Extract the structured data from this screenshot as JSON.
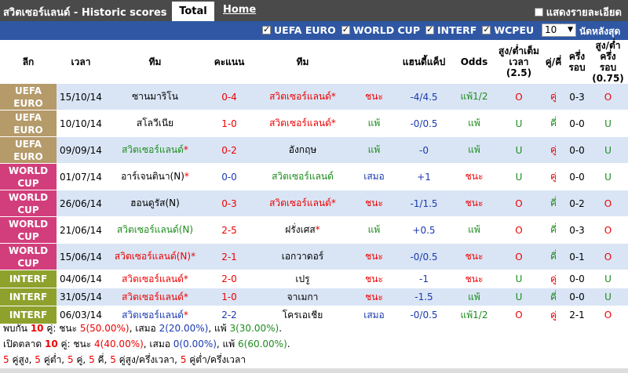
{
  "header": {
    "title": "สวิตเซอร์แลนด์ - Historic scores",
    "tab_total": "Total",
    "tab_home": "Home",
    "show_detail": "แสดงรายละเอียด"
  },
  "filters": [
    {
      "label": "UEFA EURO",
      "checked": true
    },
    {
      "label": "WORLD CUP",
      "checked": true
    },
    {
      "label": "INTERF",
      "checked": true
    },
    {
      "label": "WCPEU",
      "checked": true
    }
  ],
  "count_select": {
    "value": "10",
    "suffix": "นัดหลังสุด"
  },
  "columns": {
    "league": "ลีก",
    "time": "เวลา",
    "home": "ทีม",
    "score": "คะแนน",
    "away": "ทีม",
    "result": "",
    "handicap": "แฮนดี้แค็ป",
    "odds": "Odds",
    "ou_full_1": "สูง/ต่ำเต็ม",
    "ou_full_2": "เวลา",
    "ou_full_3": "(2.5)",
    "oe": "คู่/คี่",
    "half": "ครึ่ง",
    "half2": "รอบ",
    "ou_half_1": "สูง/ต่ำครึ่ง",
    "ou_half_2": "รอบ",
    "ou_half_3": "(0.75)"
  },
  "colors": {
    "uefa": "#b59a6a",
    "worldcup": "#d23e7b",
    "interf": "#8fa12d",
    "row_light": "#d9e5f5",
    "row_white": "#ffffff",
    "red": "#ee0000",
    "green": "#1c8c1c",
    "blue": "#1a3ab0"
  },
  "matches": [
    {
      "league1": "UEFA",
      "league2": "EURO",
      "ltype": "uefa",
      "date": "15/10/14",
      "home": "ซานมาริโน",
      "home_mark": "",
      "home_color": "black",
      "score_h": "0",
      "score_a": "4",
      "score_color": "red",
      "away": "สวิตเซอร์แลนด์",
      "away_mark": "*",
      "away_color": "red",
      "result": "ชนะ",
      "result_color": "red",
      "hcp": "-4/4.5",
      "hcp_color": "blue",
      "odds": "แพ้1/2",
      "odds_color": "green",
      "ou": "O",
      "ou_color": "red",
      "oe": "คู่",
      "oe_color": "red",
      "half": "0-3",
      "hou": "O",
      "hou_color": "red",
      "bg": "light"
    },
    {
      "league1": "UEFA",
      "league2": "EURO",
      "ltype": "uefa",
      "date": "10/10/14",
      "home": "สโลวีเนีย",
      "home_mark": "",
      "home_color": "black",
      "score_h": "1",
      "score_a": "0",
      "score_color": "red",
      "away": "สวิตเซอร์แลนด์",
      "away_mark": "*",
      "away_color": "red",
      "result": "แพ้",
      "result_color": "green",
      "hcp": "-0/0.5",
      "hcp_color": "blue",
      "odds": "แพ้",
      "odds_color": "green",
      "ou": "U",
      "ou_color": "green",
      "oe": "คี่",
      "oe_color": "green",
      "half": "0-0",
      "hou": "U",
      "hou_color": "green",
      "bg": "white"
    },
    {
      "league1": "UEFA",
      "league2": "EURO",
      "ltype": "uefa",
      "date": "09/09/14",
      "home": "สวิตเซอร์แลนด์",
      "home_mark": "*",
      "home_color": "green",
      "score_h": "0",
      "score_a": "2",
      "score_color": "red",
      "away": "อังกฤษ",
      "away_mark": "",
      "away_color": "black",
      "result": "แพ้",
      "result_color": "green",
      "hcp": "-0",
      "hcp_color": "blue",
      "odds": "แพ้",
      "odds_color": "green",
      "ou": "U",
      "ou_color": "green",
      "oe": "คู่",
      "oe_color": "red",
      "half": "0-0",
      "hou": "U",
      "hou_color": "green",
      "bg": "light"
    },
    {
      "league1": "WORLD",
      "league2": "CUP",
      "ltype": "worldcup",
      "date": "01/07/14",
      "home": "อาร์เจนตินา(N)",
      "home_mark": "*",
      "home_color": "black",
      "score_h": "0",
      "score_a": "0",
      "score_color": "blue",
      "away": "สวิตเซอร์แลนด์",
      "away_mark": "",
      "away_color": "green",
      "result": "เสมอ",
      "result_color": "blue",
      "hcp": "+1",
      "hcp_color": "blue",
      "odds": "ชนะ",
      "odds_color": "red",
      "ou": "U",
      "ou_color": "green",
      "oe": "คู่",
      "oe_color": "red",
      "half": "0-0",
      "hou": "U",
      "hou_color": "green",
      "bg": "white"
    },
    {
      "league1": "WORLD",
      "league2": "CUP",
      "ltype": "worldcup",
      "date": "26/06/14",
      "home": "ฮอนดูรัส(N)",
      "home_mark": "",
      "home_color": "black",
      "score_h": "0",
      "score_a": "3",
      "score_color": "red",
      "away": "สวิตเซอร์แลนด์",
      "away_mark": "*",
      "away_color": "red",
      "result": "ชนะ",
      "result_color": "red",
      "hcp": "-1/1.5",
      "hcp_color": "blue",
      "odds": "ชนะ",
      "odds_color": "red",
      "ou": "O",
      "ou_color": "red",
      "oe": "คี่",
      "oe_color": "green",
      "half": "0-2",
      "hou": "O",
      "hou_color": "red",
      "bg": "light"
    },
    {
      "league1": "WORLD",
      "league2": "CUP",
      "ltype": "worldcup",
      "date": "21/06/14",
      "home": "สวิตเซอร์แลนด์(N)",
      "home_mark": "",
      "home_color": "green",
      "score_h": "2",
      "score_a": "5",
      "score_color": "red",
      "away": "ฝรั่งเศส",
      "away_mark": "*",
      "away_color": "black",
      "result": "แพ้",
      "result_color": "green",
      "hcp": "+0.5",
      "hcp_color": "blue",
      "odds": "แพ้",
      "odds_color": "green",
      "ou": "O",
      "ou_color": "red",
      "oe": "คี่",
      "oe_color": "green",
      "half": "0-3",
      "hou": "O",
      "hou_color": "red",
      "bg": "white"
    },
    {
      "league1": "WORLD",
      "league2": "CUP",
      "ltype": "worldcup",
      "date": "15/06/14",
      "home": "สวิตเซอร์แลนด์(N)",
      "home_mark": "*",
      "home_color": "red",
      "score_h": "2",
      "score_a": "1",
      "score_color": "red",
      "away": "เอกวาดอร์",
      "away_mark": "",
      "away_color": "black",
      "result": "ชนะ",
      "result_color": "red",
      "hcp": "-0/0.5",
      "hcp_color": "blue",
      "odds": "ชนะ",
      "odds_color": "red",
      "ou": "O",
      "ou_color": "red",
      "oe": "คี่",
      "oe_color": "green",
      "half": "0-1",
      "hou": "O",
      "hou_color": "red",
      "bg": "light"
    },
    {
      "league1": "INTERF",
      "league2": "",
      "ltype": "interf",
      "date": "04/06/14",
      "home": "สวิตเซอร์แลนด์",
      "home_mark": "*",
      "home_color": "red",
      "score_h": "2",
      "score_a": "0",
      "score_color": "red",
      "away": "เปรู",
      "away_mark": "",
      "away_color": "black",
      "result": "ชนะ",
      "result_color": "red",
      "hcp": "-1",
      "hcp_color": "blue",
      "odds": "ชนะ",
      "odds_color": "red",
      "ou": "U",
      "ou_color": "green",
      "oe": "คู่",
      "oe_color": "red",
      "half": "0-0",
      "hou": "U",
      "hou_color": "green",
      "bg": "white",
      "short": true
    },
    {
      "league1": "INTERF",
      "league2": "",
      "ltype": "interf",
      "date": "31/05/14",
      "home": "สวิตเซอร์แลนด์",
      "home_mark": "*",
      "home_color": "red",
      "score_h": "1",
      "score_a": "0",
      "score_color": "red",
      "away": "จาเมกา",
      "away_mark": "",
      "away_color": "black",
      "result": "ชนะ",
      "result_color": "red",
      "hcp": "-1.5",
      "hcp_color": "blue",
      "odds": "แพ้",
      "odds_color": "green",
      "ou": "U",
      "ou_color": "green",
      "oe": "คี่",
      "oe_color": "green",
      "half": "0-0",
      "hou": "U",
      "hou_color": "green",
      "bg": "light",
      "short": true
    },
    {
      "league1": "INTERF",
      "league2": "",
      "ltype": "interf",
      "date": "06/03/14",
      "home": "สวิตเซอร์แลนด์",
      "home_mark": "*",
      "home_color": "blue",
      "score_h": "2",
      "score_a": "2",
      "score_color": "blue",
      "away": "โครเอเชีย",
      "away_mark": "",
      "away_color": "black",
      "result": "เสมอ",
      "result_color": "blue",
      "hcp": "-0/0.5",
      "hcp_color": "blue",
      "odds": "แพ้1/2",
      "odds_color": "green",
      "ou": "O",
      "ou_color": "red",
      "oe": "คู่",
      "oe_color": "red",
      "half": "2-1",
      "hou": "O",
      "hou_color": "red",
      "bg": "white",
      "short": true
    }
  ],
  "summary": {
    "line1": {
      "p1": "พบกัน ",
      "n": "10",
      "p2": " คู่: ชนะ ",
      "w": "5(50.00%)",
      "p3": ", เสมอ ",
      "d": "2(20.00%)",
      "p4": ", แพ้ ",
      "l": "3(30.00%)",
      "p5": "."
    },
    "line2": {
      "p1": "เปิดตลาด ",
      "n": "10",
      "p2": " คู่: ชนะ ",
      "w": "4(40.00%)",
      "p3": ", เสมอ ",
      "d": "0(0.00%)",
      "p4": ", แพ้ ",
      "l": "6(60.00%)",
      "p5": "."
    },
    "line3": {
      "a": "5",
      "a_t": " คู่สูง, ",
      "b": "5",
      "b_t": " คู่ต่ำ, ",
      "c": "5",
      "c_t": " คู่, ",
      "d": "5",
      "d_t": " คี่, ",
      "e": "5",
      "e_t": " คู่สูง/ครึ่งเวลา, ",
      "f": "5",
      "f_t": " คู่ต่ำ/ครึ่งเวลา"
    }
  }
}
